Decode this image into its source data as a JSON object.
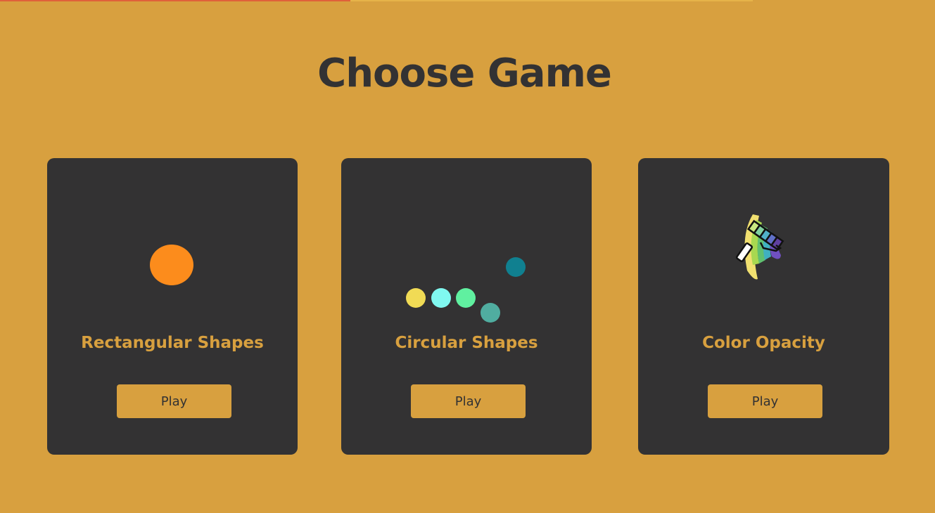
{
  "page": {
    "title": "Choose Game"
  },
  "cards": [
    {
      "title": "Rectangular Shapes",
      "button_label": "Play",
      "icon": "orange-circle-icon"
    },
    {
      "title": "Circular Shapes",
      "button_label": "Play",
      "icon": "colored-dots-icon"
    },
    {
      "title": "Color Opacity",
      "button_label": "Play",
      "icon": "paint-palette-roller-icon"
    }
  ],
  "colors": {
    "background": "#d8a03f",
    "card": "#333233",
    "accent": "#d8a03f",
    "text_dark": "#333233"
  }
}
